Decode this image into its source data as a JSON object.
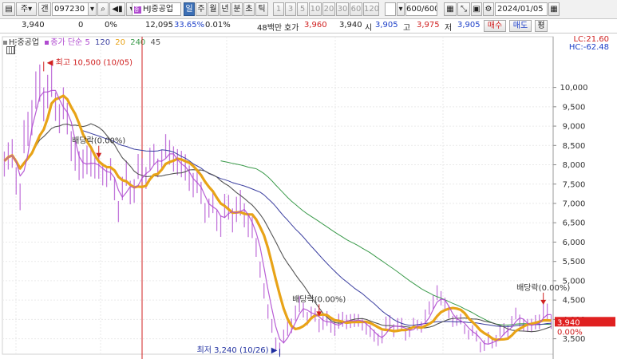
{
  "toolbar": {
    "market": "주",
    "search_mode": "갠",
    "code": "097230",
    "stock_name": "HJ중공업",
    "periods": [
      "일",
      "주",
      "월",
      "년",
      "분",
      "초",
      "틱"
    ],
    "active_period": "일",
    "minutes": [
      "1",
      "3",
      "5",
      "10",
      "20",
      "30",
      "60",
      "120"
    ],
    "count": "600/600",
    "date": "2024/01/05"
  },
  "quote": {
    "price": "3,940",
    "change": "0",
    "change_pct": "0%",
    "volume": "12,095",
    "turnover_pct": "33.65%",
    "vol_ratio": "0.01%",
    "trade_value": "48백만",
    "ask_label": "호가",
    "ask": "3,960",
    "bid": "3,940",
    "open_label": "시",
    "open": "3,905",
    "high_label": "고",
    "high": "3,975",
    "low_label": "저",
    "low": "3,905",
    "buy_label": "매수",
    "sell_label": "매도",
    "eval_label": "평"
  },
  "legend": {
    "name": "HJ중공업",
    "ma_label": "종가 단순",
    "periods": [
      "5",
      "120",
      "20",
      "240",
      "45"
    ],
    "colors": [
      "#b04bd0",
      "#3b3fa0",
      "#e8a317",
      "#3a9a4a",
      "#555555"
    ]
  },
  "right_info": {
    "lc": "LC:21.60",
    "hc": "HC:-62.48"
  },
  "colors": {
    "price": "#b04bd0",
    "ma5": "#b04bd0",
    "ma20": "#e8a317",
    "ma45": "#555555",
    "ma120": "#3b3fa0",
    "ma240": "#3a9a4a",
    "current_price_box": "#e02020",
    "annotation": "#d02020",
    "low_annotation": "#2030a0"
  },
  "chart_data": {
    "type": "line",
    "ylim": [
      3100,
      10900
    ],
    "yticks": [
      3500,
      4000,
      4500,
      5000,
      5500,
      6000,
      6500,
      7000,
      7500,
      8000,
      8500,
      9000,
      9500,
      10000
    ],
    "ytick_labels": [
      "3,500",
      "4,000",
      "4,500",
      "5,000",
      "5,500",
      "6,000",
      "6,500",
      "7,000",
      "7,500",
      "8,000",
      "8,500",
      "9,000",
      "9,500",
      "10,000"
    ],
    "n_points": 140,
    "current_price": {
      "value": 3940,
      "label": "3,940",
      "change_label": "0.00%"
    },
    "annotations": [
      {
        "text": "최고 10,500 (10/05)",
        "index": 10,
        "value": 10500,
        "type": "high"
      },
      {
        "text": "최저 3,240 (10/26)",
        "index": 70,
        "value": 3240,
        "type": "low"
      },
      {
        "text": "배당락(0.00%)",
        "index": 24,
        "value": 8100,
        "type": "dividend"
      },
      {
        "text": "배당락(0.00%)",
        "index": 80,
        "value": 4000,
        "type": "dividend"
      },
      {
        "text": "배당락(0.00%)",
        "index": 137,
        "value": 4300,
        "type": "dividend"
      }
    ],
    "price_anchors": [
      [
        0,
        8100
      ],
      [
        2,
        8300
      ],
      [
        4,
        7200
      ],
      [
        5,
        8500
      ],
      [
        7,
        9500
      ],
      [
        9,
        9900
      ],
      [
        11,
        10000
      ],
      [
        13,
        9700
      ],
      [
        15,
        9400
      ],
      [
        17,
        8700
      ],
      [
        19,
        7800
      ],
      [
        21,
        8200
      ],
      [
        23,
        7900
      ],
      [
        25,
        7900
      ],
      [
        27,
        7700
      ],
      [
        29,
        7000
      ],
      [
        31,
        7500
      ],
      [
        33,
        7400
      ],
      [
        35,
        7800
      ],
      [
        37,
        8000
      ],
      [
        39,
        8100
      ],
      [
        41,
        8300
      ],
      [
        43,
        8200
      ],
      [
        45,
        7900
      ],
      [
        47,
        7700
      ],
      [
        49,
        7400
      ],
      [
        51,
        7000
      ],
      [
        53,
        6800
      ],
      [
        55,
        6600
      ],
      [
        57,
        6800
      ],
      [
        59,
        6800
      ],
      [
        61,
        6800
      ],
      [
        63,
        6300
      ],
      [
        65,
        5400
      ],
      [
        67,
        4200
      ],
      [
        69,
        3400
      ],
      [
        70,
        3300
      ],
      [
        72,
        3700
      ],
      [
        74,
        4200
      ],
      [
        76,
        4300
      ],
      [
        78,
        4100
      ],
      [
        80,
        4000
      ],
      [
        82,
        3900
      ],
      [
        84,
        3850
      ],
      [
        86,
        3950
      ],
      [
        88,
        4000
      ],
      [
        90,
        3950
      ],
      [
        92,
        3850
      ],
      [
        94,
        3500
      ],
      [
        96,
        3600
      ],
      [
        98,
        3900
      ],
      [
        100,
        3800
      ],
      [
        102,
        3700
      ],
      [
        104,
        3800
      ],
      [
        106,
        3900
      ],
      [
        108,
        4200
      ],
      [
        110,
        4700
      ],
      [
        112,
        4300
      ],
      [
        114,
        4000
      ],
      [
        116,
        3900
      ],
      [
        118,
        3700
      ],
      [
        120,
        3500
      ],
      [
        122,
        3300
      ],
      [
        124,
        3450
      ],
      [
        126,
        3600
      ],
      [
        128,
        3800
      ],
      [
        130,
        4100
      ],
      [
        132,
        3900
      ],
      [
        134,
        3800
      ],
      [
        136,
        4000
      ],
      [
        137,
        4250
      ],
      [
        139,
        3940
      ]
    ],
    "series": [
      {
        "name": "5",
        "color": "#b04bd0",
        "values": []
      },
      {
        "name": "20",
        "color": "#e8a317",
        "values": []
      },
      {
        "name": "45",
        "color": "#555555",
        "values": []
      },
      {
        "name": "120",
        "color": "#3b3fa0",
        "values": []
      },
      {
        "name": "240",
        "color": "#3a9a4a",
        "values": []
      }
    ]
  }
}
